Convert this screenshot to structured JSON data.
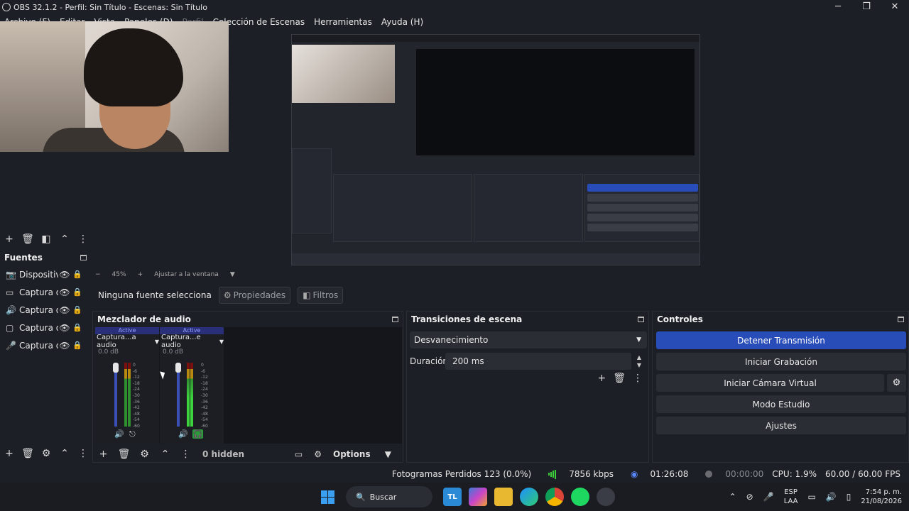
{
  "window": {
    "title": "OBS 32.1.2 - Perfil: Sin Título - Escenas: Sin Título",
    "controls": [
      "─",
      "❐",
      "✕"
    ]
  },
  "menu": [
    "Archivo (F)",
    "Editar",
    "Vista",
    "Paneles (D)",
    "Perfil",
    "Colección de Escenas",
    "Herramientas",
    "Ayuda (H)"
  ],
  "zoom": {
    "minus": "−",
    "level": "45%",
    "plus": "+",
    "fit": "Ajustar a la ventana"
  },
  "sources": {
    "title": "Fuentes",
    "items": [
      {
        "icon": "camera-icon",
        "glyph": "📷",
        "label": "Dispositiv"
      },
      {
        "icon": "window-capture-icon",
        "glyph": "▭",
        "label": "Captura d"
      },
      {
        "icon": "speaker-icon",
        "glyph": "🔊",
        "label": "Captura d"
      },
      {
        "icon": "monitor-icon",
        "glyph": "▢",
        "label": "Captura d"
      },
      {
        "icon": "microphone-icon",
        "glyph": "🎤",
        "label": "Captura d"
      }
    ]
  },
  "context_bar": {
    "no_source": "Ninguna fuente selecciona",
    "properties": "Propiedades",
    "filters": "Filtros"
  },
  "mixer": {
    "title": "Mezclador de audio",
    "channels": [
      {
        "status": "Active",
        "name": "Captura...a audio",
        "db": "0.0 dB"
      },
      {
        "status": "Active",
        "name": "Captura...e audio",
        "db": "0.0 dB"
      }
    ],
    "scale": [
      "0",
      "-6",
      "-12",
      "-18",
      "-24",
      "-30",
      "-36",
      "-42",
      "-48",
      "-54",
      "-60"
    ],
    "hidden": "0 hidden",
    "options": "Options"
  },
  "transitions": {
    "title": "Transiciones de escena",
    "selected": "Desvanecimiento",
    "duration_label": "Duración",
    "duration_value": "200 ms"
  },
  "controls": {
    "title": "Controles",
    "stop_stream": "Detener Transmisión",
    "start_recording": "Iniciar Grabación",
    "virtual_camera": "Iniciar Cámara Virtual",
    "studio_mode": "Modo Estudio",
    "settings": "Ajustes"
  },
  "status": {
    "dropped_frames": "Fotogramas Perdidos 123 (0.0%)",
    "bitrate": "7856 kbps",
    "stream_time": "01:26:08",
    "record_time": "00:00:00",
    "cpu": "CPU: 1.9%",
    "fps": "60.00 / 60.00 FPS"
  },
  "taskbar": {
    "search": "Buscar",
    "lang_top": "ESP",
    "lang_bottom": "LAA",
    "time": "7:54 p. m.",
    "date": "21/08/2026"
  },
  "colors": {
    "accent": "#284cb8",
    "meter_green": "#3dd33d",
    "background": "#1d1f26"
  }
}
